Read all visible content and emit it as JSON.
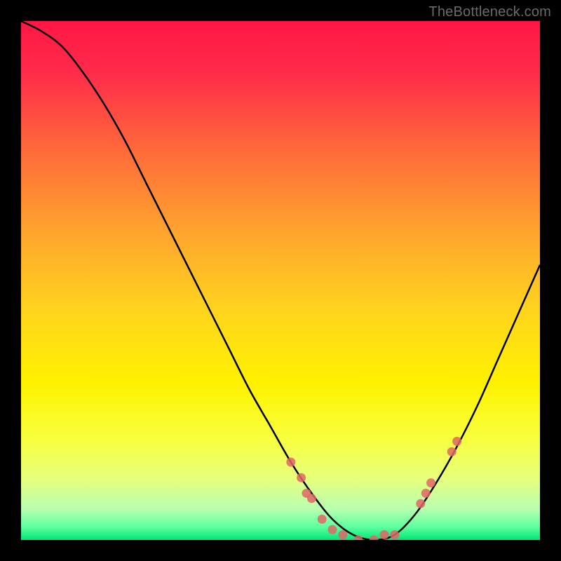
{
  "watermark": "TheBottleneck.com",
  "gradient": {
    "stops": [
      {
        "offset": 0.0,
        "color": "#ff1744"
      },
      {
        "offset": 0.1,
        "color": "#ff2b4a"
      },
      {
        "offset": 0.25,
        "color": "#ff6a3a"
      },
      {
        "offset": 0.4,
        "color": "#ffa22e"
      },
      {
        "offset": 0.55,
        "color": "#ffd21f"
      },
      {
        "offset": 0.7,
        "color": "#fff200"
      },
      {
        "offset": 0.8,
        "color": "#f8ff3a"
      },
      {
        "offset": 0.88,
        "color": "#e8ff7a"
      },
      {
        "offset": 0.94,
        "color": "#b8ffb0"
      },
      {
        "offset": 0.975,
        "color": "#5eff9e"
      },
      {
        "offset": 1.0,
        "color": "#00e676"
      }
    ]
  },
  "chart_data": {
    "type": "line",
    "title": "",
    "xlabel": "",
    "ylabel": "",
    "xlim": [
      0,
      100
    ],
    "ylim": [
      0,
      100
    ],
    "series": [
      {
        "name": "bottleneck-curve",
        "x": [
          0,
          4,
          8,
          12,
          16,
          20,
          24,
          28,
          32,
          36,
          40,
          44,
          48,
          52,
          56,
          60,
          64,
          68,
          72,
          76,
          80,
          84,
          88,
          92,
          96,
          100
        ],
        "y": [
          100,
          98,
          95,
          90,
          84,
          77,
          69,
          61,
          53,
          45,
          37,
          29,
          22,
          15,
          9,
          4,
          1,
          0,
          1,
          5,
          11,
          18,
          26,
          35,
          44,
          53
        ]
      }
    ],
    "scatter_points": {
      "name": "highlighted-points",
      "color": "#e06666",
      "points": [
        {
          "x": 52,
          "y": 15
        },
        {
          "x": 54,
          "y": 12
        },
        {
          "x": 55,
          "y": 9
        },
        {
          "x": 56,
          "y": 8
        },
        {
          "x": 58,
          "y": 4
        },
        {
          "x": 60,
          "y": 2
        },
        {
          "x": 62,
          "y": 1
        },
        {
          "x": 65,
          "y": 0
        },
        {
          "x": 68,
          "y": 0
        },
        {
          "x": 70,
          "y": 1
        },
        {
          "x": 72,
          "y": 1
        },
        {
          "x": 77,
          "y": 7
        },
        {
          "x": 78,
          "y": 9
        },
        {
          "x": 79,
          "y": 11
        },
        {
          "x": 83,
          "y": 17
        },
        {
          "x": 84,
          "y": 19
        }
      ]
    }
  }
}
